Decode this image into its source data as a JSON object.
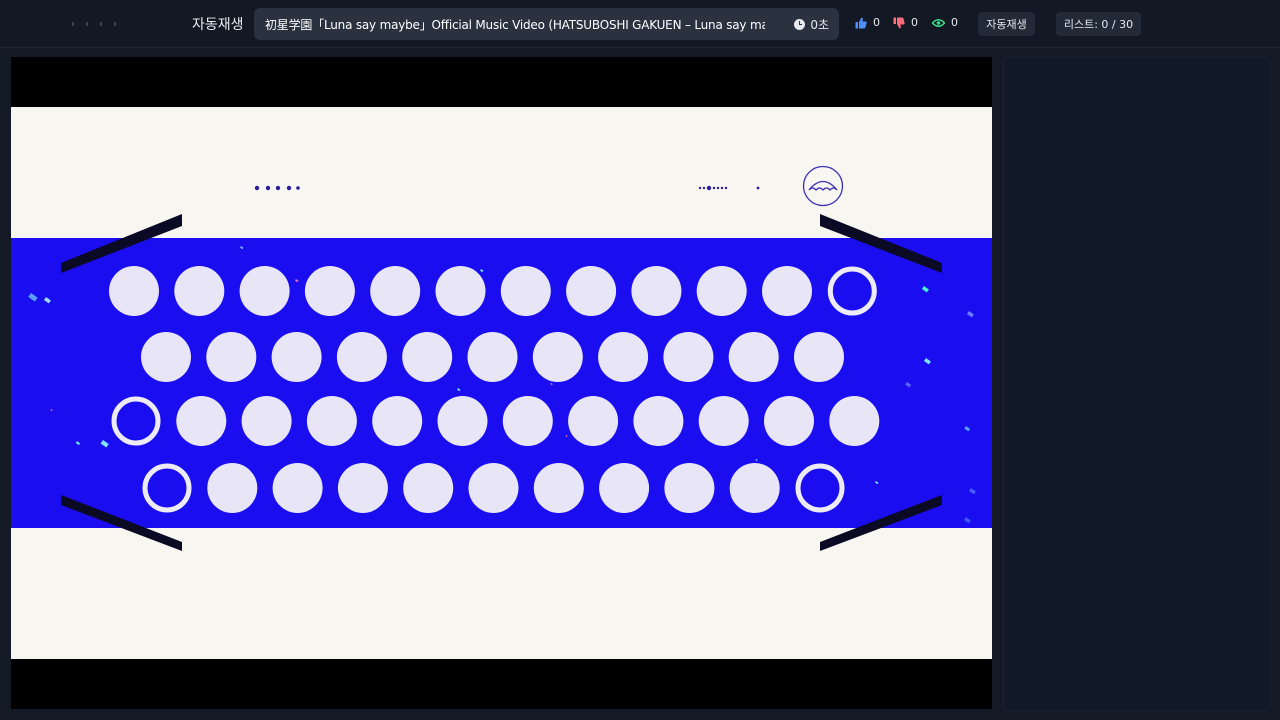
{
  "header": {
    "autoplay_title": "자동재생",
    "video_title": "初星学園「Luna say maybe」Official Music Video (HATSUBOSHI GAKUEN – Luna say maybe)",
    "timer": "0초",
    "likes": "0",
    "dislikes": "0",
    "views": "0",
    "autoplay_button": "자동재생",
    "playlist_counter": "리스트: 0 / 30"
  },
  "colors": {
    "background": "#131a26",
    "accent_like": "#4f8cff",
    "accent_dislike": "#ff6b7a",
    "accent_view": "#3ddc84",
    "video_blue": "#1a0ef0",
    "video_cream": "#f8f6f1"
  },
  "icons": {
    "clock": "clock-icon",
    "like": "thumbs-up-icon",
    "dislike": "thumbs-down-icon",
    "view": "eye-icon"
  }
}
